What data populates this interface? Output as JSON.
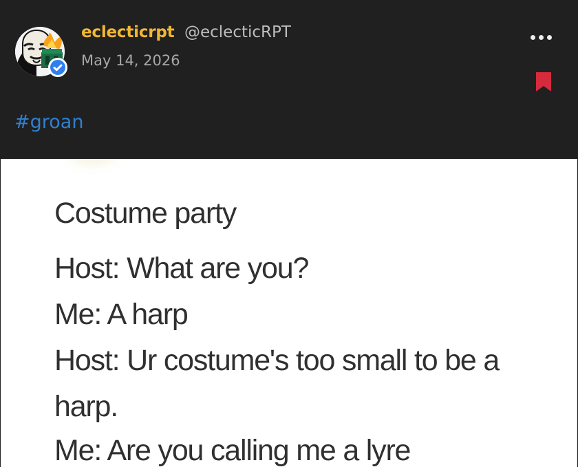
{
  "post": {
    "username": "eclecticrpt",
    "handle": "@eclecticRPT",
    "date": "May 14, 2026",
    "hashtag": "#groan",
    "colors": {
      "background": "#202020",
      "username": "#f2b733",
      "hashtag": "#2f80d1",
      "bookmark": "#d62b3d",
      "verified_badge": "#2f80ed"
    },
    "icons": {
      "more": "more-horizontal-icon",
      "bookmark": "bookmark-icon",
      "verified": "verified-badge-icon"
    }
  },
  "image_text": {
    "lines": [
      "Costume party",
      "Host: What are you?",
      "Me: A harp",
      "Host: Ur costume's too small to be a",
      "harp.",
      "Me: Are you calling me a lyre"
    ]
  }
}
